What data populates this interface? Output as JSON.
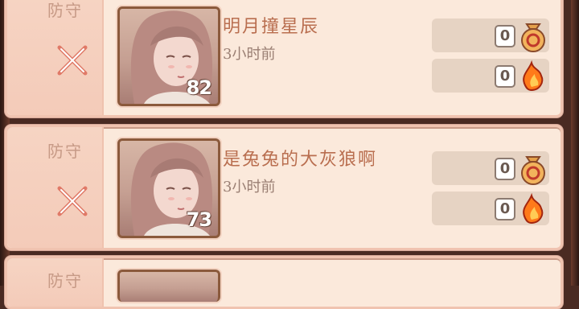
{
  "entries": [
    {
      "mode": "防守",
      "name": "明月撞星辰",
      "time": "3小时前",
      "level": "82",
      "resources": [
        {
          "icon": "money-bag-icon",
          "count": "0"
        },
        {
          "icon": "flame-icon",
          "count": "0"
        }
      ]
    },
    {
      "mode": "防守",
      "name": "是兔兔的大灰狼啊",
      "time": "3小时前",
      "level": "73",
      "resources": [
        {
          "icon": "money-bag-icon",
          "count": "0"
        },
        {
          "icon": "flame-icon",
          "count": "0"
        }
      ]
    },
    {
      "mode": "防守",
      "name": "",
      "time": "",
      "level": "",
      "resources": []
    }
  ],
  "colors": {
    "card_bg": "#fbe9db",
    "card_border": "#f0c3b0",
    "name_text": "#b96e4f",
    "resource_bg": "#e6d3c3"
  }
}
